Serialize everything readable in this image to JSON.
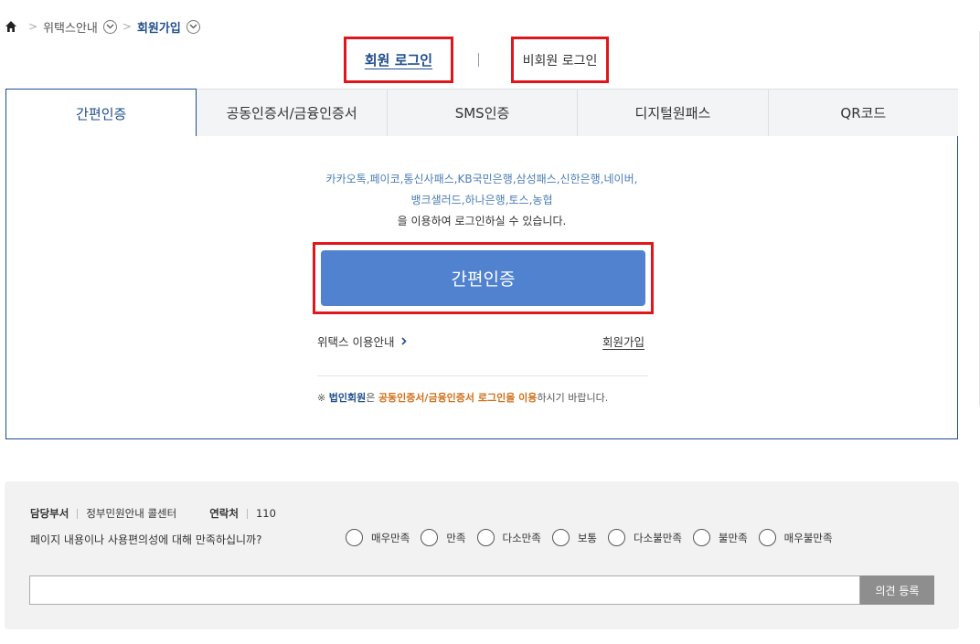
{
  "breadcrumb": {
    "home_icon": "home-icon",
    "items": [
      {
        "label": "위택스안내"
      },
      {
        "label": "회원가입"
      }
    ]
  },
  "login_type": {
    "member_label": "회원 로그인",
    "guest_label": "비회원 로그인"
  },
  "tabs": [
    {
      "label": "간편인증",
      "active": true
    },
    {
      "label": "공동인증서/금융인증서",
      "active": false
    },
    {
      "label": "SMS인증",
      "active": false
    },
    {
      "label": "디지털원패스",
      "active": false
    },
    {
      "label": "QR코드",
      "active": false
    }
  ],
  "panel": {
    "providers_line1": "카카오톡,페이코,통신사패스,KB국민은행,삼성패스,신한은행,네이버,",
    "providers_line2": "뱅크샐러드,하나은행,토스,농협",
    "description": "을 이용하여 로그인하실 수 있습니다.",
    "easy_button_label": "간편인증",
    "guide_link": "위택스 이용안내",
    "join_link": "회원가입",
    "notice": {
      "prefix": "※ ",
      "corp": "법인회원",
      "mid": "은 ",
      "cert": "공동인증서/금융인증서 로그인을 이용",
      "suffix": "하시기 바랍니다."
    }
  },
  "survey": {
    "dept_label": "담당부서",
    "dept_value": "정부민원안내 콜센터",
    "contact_label": "연락처",
    "contact_value": "110",
    "question": "페이지 내용이나 사용편의성에 대해 만족하십니까?",
    "options": [
      "매우만족",
      "만족",
      "다소만족",
      "보통",
      "다소불만족",
      "불만족",
      "매우불만족"
    ],
    "input_placeholder": "",
    "submit_label": "의견 등록"
  },
  "colors": {
    "accent": "#1f4e8c",
    "button": "#5082cf",
    "highlight": "#e0161d",
    "provider_text": "#4a7db5",
    "notice_orange": "#d0701b"
  }
}
